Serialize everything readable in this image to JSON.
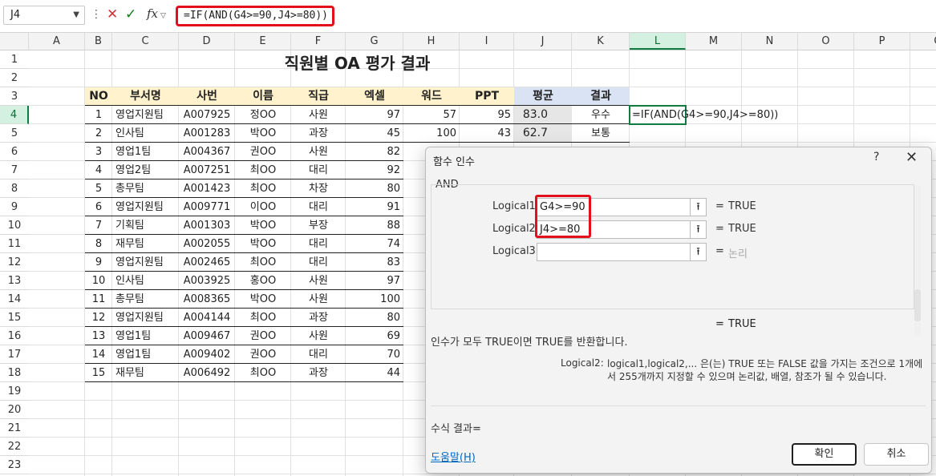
{
  "formula_bar": {
    "cell_ref": "J4",
    "fx": "fx",
    "formula": "=IF(AND(G4>=90,J4>=80))"
  },
  "columns": [
    "A",
    "B",
    "C",
    "D",
    "E",
    "F",
    "G",
    "H",
    "I",
    "J",
    "K",
    "L",
    "M",
    "N",
    "O",
    "P",
    "Q"
  ],
  "rows": [
    "1",
    "2",
    "3",
    "4",
    "5",
    "6",
    "7",
    "8",
    "9",
    "10",
    "11",
    "12",
    "13",
    "14",
    "15",
    "16",
    "17",
    "18",
    "19",
    "20",
    "21",
    "22",
    "23"
  ],
  "sheet": {
    "title": "직원별 OA 평가 결과",
    "headers": [
      "NO",
      "부서명",
      "사번",
      "이름",
      "직급",
      "엑셀",
      "워드",
      "PPT",
      "평균",
      "결과"
    ],
    "data": [
      {
        "no": "1",
        "dept": "영업지원팀",
        "id": "A007925",
        "name": "정OO",
        "rank": "사원",
        "excel": "97",
        "word": "57",
        "ppt": "95",
        "avg": "83.0",
        "result": "우수"
      },
      {
        "no": "2",
        "dept": "인사팀",
        "id": "A001283",
        "name": "박OO",
        "rank": "과장",
        "excel": "45",
        "word": "100",
        "ppt": "43",
        "avg": "62.7",
        "result": "보통"
      },
      {
        "no": "3",
        "dept": "영업1팀",
        "id": "A004367",
        "name": "권OO",
        "rank": "사원",
        "excel": "82"
      },
      {
        "no": "4",
        "dept": "영업2팀",
        "id": "A007251",
        "name": "최OO",
        "rank": "대리",
        "excel": "92"
      },
      {
        "no": "5",
        "dept": "총무팀",
        "id": "A001423",
        "name": "최OO",
        "rank": "차장",
        "excel": "80"
      },
      {
        "no": "6",
        "dept": "영업지원팀",
        "id": "A009771",
        "name": "이OO",
        "rank": "대리",
        "excel": "91"
      },
      {
        "no": "7",
        "dept": "기획팀",
        "id": "A001303",
        "name": "박OO",
        "rank": "부장",
        "excel": "88"
      },
      {
        "no": "8",
        "dept": "재무팀",
        "id": "A002055",
        "name": "박OO",
        "rank": "대리",
        "excel": "74"
      },
      {
        "no": "9",
        "dept": "영업지원팀",
        "id": "A002465",
        "name": "최OO",
        "rank": "대리",
        "excel": "83"
      },
      {
        "no": "10",
        "dept": "인사팀",
        "id": "A003925",
        "name": "홍OO",
        "rank": "사원",
        "excel": "97"
      },
      {
        "no": "11",
        "dept": "총무팀",
        "id": "A008365",
        "name": "박OO",
        "rank": "사원",
        "excel": "100"
      },
      {
        "no": "12",
        "dept": "영업지원팀",
        "id": "A004144",
        "name": "최OO",
        "rank": "과장",
        "excel": "80"
      },
      {
        "no": "13",
        "dept": "영업1팀",
        "id": "A009467",
        "name": "권OO",
        "rank": "사원",
        "excel": "69"
      },
      {
        "no": "14",
        "dept": "영업1팀",
        "id": "A009402",
        "name": "권OO",
        "rank": "대리",
        "excel": "70"
      },
      {
        "no": "15",
        "dept": "재무팀",
        "id": "A006492",
        "name": "최OO",
        "rank": "과장",
        "excel": "44"
      }
    ],
    "l4_text": "=IF(AND(G4>=90,J4>=80))"
  },
  "dialog": {
    "title": "함수 인수",
    "help": "?",
    "close": "✕",
    "function_name": "AND",
    "args": [
      {
        "label": "Logical1",
        "value": "G4>=90",
        "result": "TRUE"
      },
      {
        "label": "Logical2",
        "value": "J4>=80",
        "result": "TRUE"
      },
      {
        "label": "Logical3",
        "value": "",
        "result": "논리"
      }
    ],
    "equals": "=",
    "overall_result": "TRUE",
    "description": "인수가 모두 TRUE이면 TRUE를 반환합니다.",
    "arg_desc_label": "Logical2:",
    "arg_desc_text": "logical1,logical2,... 은(는) TRUE 또는 FALSE 값을 가지는 조건으로 1개에서 255개까지 지정할 수 있으며 논리값, 배열, 참조가 될 수 있습니다.",
    "formula_result_label": "수식 결과=",
    "help_link": "도움말(H)",
    "ok": "확인",
    "cancel": "취소"
  }
}
